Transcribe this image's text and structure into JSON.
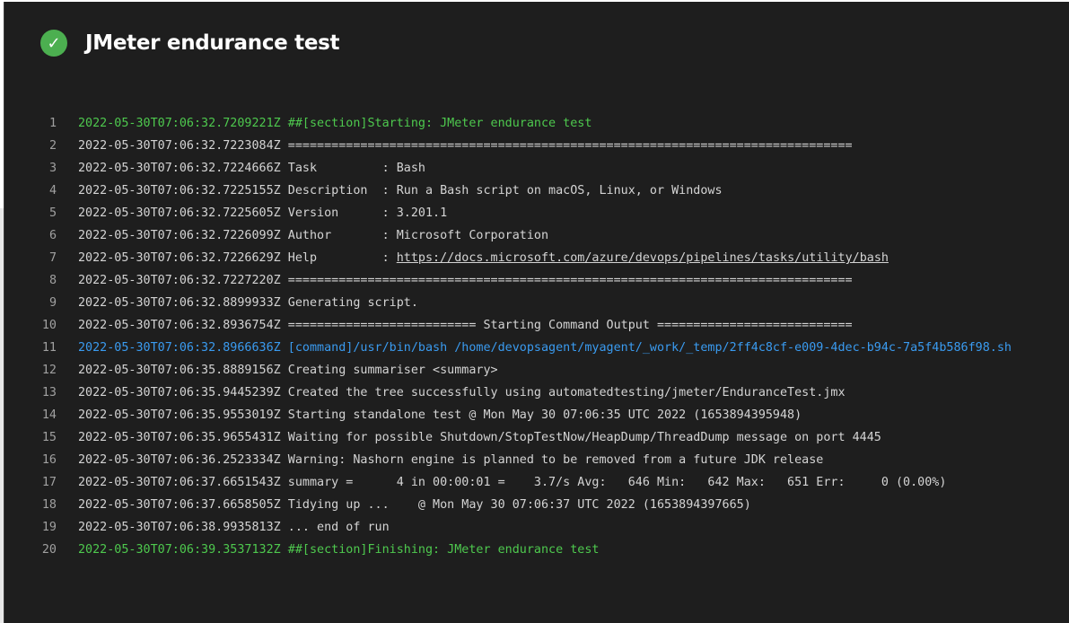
{
  "header": {
    "status_icon": "check-circle-icon",
    "title": "JMeter endurance test"
  },
  "log": {
    "lines": [
      {
        "n": "1",
        "text": "2022-05-30T07:06:32.7209221Z ##[section]Starting: JMeter endurance test",
        "kind": "section"
      },
      {
        "n": "2",
        "text": "2022-05-30T07:06:32.7223084Z ==============================================================================",
        "kind": "normal"
      },
      {
        "n": "3",
        "text": "2022-05-30T07:06:32.7224666Z Task         : Bash",
        "kind": "normal"
      },
      {
        "n": "4",
        "text": "2022-05-30T07:06:32.7225155Z Description  : Run a Bash script on macOS, Linux, or Windows",
        "kind": "normal"
      },
      {
        "n": "5",
        "text": "2022-05-30T07:06:32.7225605Z Version      : 3.201.1",
        "kind": "normal"
      },
      {
        "n": "6",
        "text": "2022-05-30T07:06:32.7226099Z Author       : Microsoft Corporation",
        "kind": "normal"
      },
      {
        "n": "7",
        "prefix": "2022-05-30T07:06:32.7226629Z Help         : ",
        "link": "https://docs.microsoft.com/azure/devops/pipelines/tasks/utility/bash",
        "kind": "link"
      },
      {
        "n": "8",
        "text": "2022-05-30T07:06:32.7227220Z ==============================================================================",
        "kind": "normal"
      },
      {
        "n": "9",
        "text": "2022-05-30T07:06:32.8899933Z Generating script.",
        "kind": "normal"
      },
      {
        "n": "10",
        "text": "2022-05-30T07:06:32.8936754Z ========================== Starting Command Output ===========================",
        "kind": "normal"
      },
      {
        "n": "11",
        "text": "2022-05-30T07:06:32.8966636Z [command]/usr/bin/bash /home/devopsagent/myagent/_work/_temp/2ff4c8cf-e009-4dec-b94c-7a5f4b586f98.sh",
        "kind": "command"
      },
      {
        "n": "12",
        "text": "2022-05-30T07:06:35.8889156Z Creating summariser <summary>",
        "kind": "normal"
      },
      {
        "n": "13",
        "text": "2022-05-30T07:06:35.9445239Z Created the tree successfully using automatedtesting/jmeter/EnduranceTest.jmx",
        "kind": "normal"
      },
      {
        "n": "14",
        "text": "2022-05-30T07:06:35.9553019Z Starting standalone test @ Mon May 30 07:06:35 UTC 2022 (1653894395948)",
        "kind": "normal"
      },
      {
        "n": "15",
        "text": "2022-05-30T07:06:35.9655431Z Waiting for possible Shutdown/StopTestNow/HeapDump/ThreadDump message on port 4445",
        "kind": "normal"
      },
      {
        "n": "16",
        "text": "2022-05-30T07:06:36.2523334Z Warning: Nashorn engine is planned to be removed from a future JDK release",
        "kind": "normal"
      },
      {
        "n": "17",
        "text": "2022-05-30T07:06:37.6651543Z summary =      4 in 00:00:01 =    3.7/s Avg:   646 Min:   642 Max:   651 Err:     0 (0.00%)",
        "kind": "normal"
      },
      {
        "n": "18",
        "text": "2022-05-30T07:06:37.6658505Z Tidying up ...    @ Mon May 30 07:06:37 UTC 2022 (1653894397665)",
        "kind": "normal"
      },
      {
        "n": "19",
        "text": "2022-05-30T07:06:38.9935813Z ... end of run",
        "kind": "normal"
      },
      {
        "n": "20",
        "text": "2022-05-30T07:06:39.3537132Z ##[section]Finishing: JMeter endurance test",
        "kind": "section"
      }
    ]
  },
  "colors": {
    "background": "#1e1e1e",
    "section_text": "#4ec94e",
    "command_text": "#3a9bf0",
    "success": "#4caf50"
  }
}
